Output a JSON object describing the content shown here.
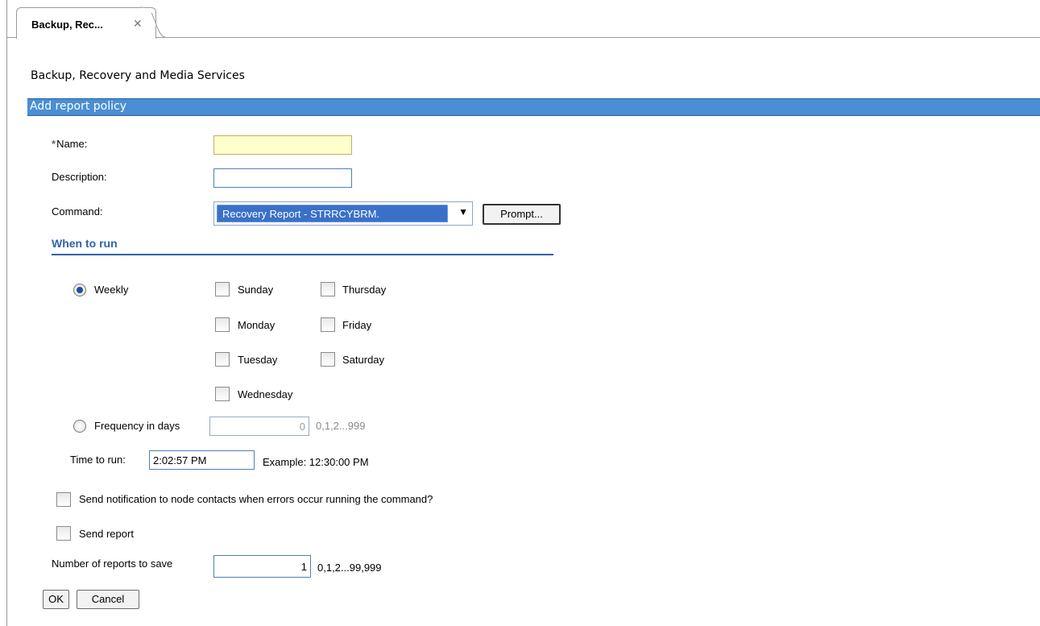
{
  "tab": {
    "label": "Backup, Rec...",
    "close_glyph": "✕"
  },
  "page_title": "Backup, Recovery and Media Services",
  "section_title": "Add report policy",
  "form": {
    "name": {
      "required_marker": "*",
      "label": "Name:",
      "value": ""
    },
    "description": {
      "label": "Description:",
      "value": ""
    },
    "command": {
      "label": "Command:",
      "selected": "Recovery Report - STRRCYBRM.",
      "arrow": "▼",
      "prompt_button": "Prompt..."
    }
  },
  "when_to_run": {
    "title": "When to run",
    "weekly": {
      "label": "Weekly",
      "selected": true
    },
    "days": [
      {
        "label": "Sunday",
        "checked": false
      },
      {
        "label": "Thursday",
        "checked": false
      },
      {
        "label": "Monday",
        "checked": false
      },
      {
        "label": "Friday",
        "checked": false
      },
      {
        "label": "Tuesday",
        "checked": false
      },
      {
        "label": "Saturday",
        "checked": false
      },
      {
        "label": "Wednesday",
        "checked": false
      }
    ],
    "frequency": {
      "label": "Frequency in days",
      "value": "0",
      "hint": "0,1,2...999",
      "selected": false
    },
    "time_to_run": {
      "label": "Time to run:",
      "value": "2:02:57 PM",
      "example": "Example: 12:30:00 PM"
    }
  },
  "notify": {
    "label": "Send notification to node contacts when errors occur running the command?",
    "checked": false
  },
  "send_report": {
    "label": "Send report",
    "checked": false
  },
  "reports_to_save": {
    "label": "Number of reports to save",
    "value": "1",
    "hint": "0,1,2...99,999"
  },
  "buttons": {
    "ok": "OK",
    "cancel": "Cancel"
  },
  "colors": {
    "section_bar": "#4a8fd3",
    "accent": "#2e64a8",
    "name_field": "#ffffcc",
    "selection": "#3a70c8"
  }
}
